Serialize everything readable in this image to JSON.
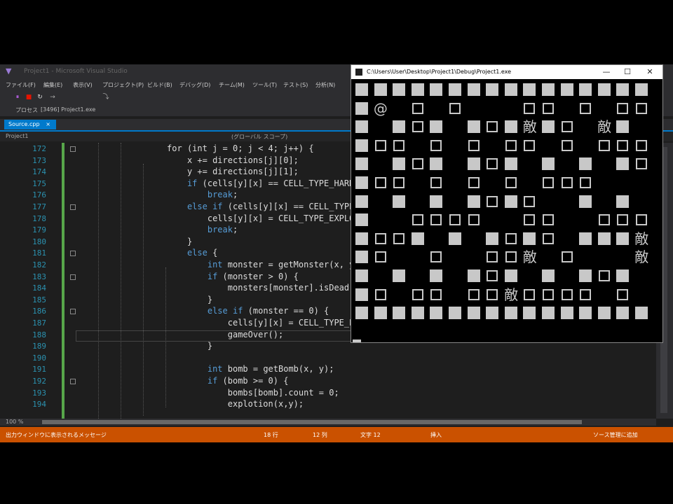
{
  "ide": {
    "title": "Project1 - Microsoft Visual Studio",
    "menu": [
      "ファイル(F)",
      "編集(E)",
      "表示(V)",
      "プロジェクト(P)",
      "ビルド(B)",
      "デバッグ(D)",
      "チーム(M)",
      "ツール(T)",
      "テスト(S)",
      "分析(N)"
    ],
    "toolbar2": [
      "プロセス",
      "[3496] Project1.exe"
    ],
    "tab": "Source.cpp",
    "tab_close": "×",
    "nav_project": "Project1",
    "nav_scope": "(グローバル スコープ)",
    "zoom": "100 %",
    "line_numbers": [
      "172",
      "173",
      "174",
      "175",
      "176",
      "177",
      "178",
      "179",
      "180",
      "181",
      "182",
      "183",
      "184",
      "185",
      "186",
      "187",
      "188",
      "189",
      "190",
      "191",
      "192",
      "193",
      "194"
    ],
    "code": [
      {
        "t": "                  for (int j = 0; j < 4; j++) {",
        "k": []
      },
      {
        "t": "                      x += directions[j][0];",
        "k": []
      },
      {
        "t": "                      y += directions[j][1];",
        "k": []
      },
      {
        "t": "                      if (cells[y][x] == CELL_TYPE_HARD_BLOCK)",
        "k": [
          "if"
        ]
      },
      {
        "t": "                          break;",
        "k": [
          "break"
        ]
      },
      {
        "t": "                      else if (cells[y][x] == CELL_TYPE_SOFT_",
        "k": [
          "else if"
        ]
      },
      {
        "t": "                          cells[y][x] = CELL_TYPE_EXPLOSION;",
        "k": []
      },
      {
        "t": "                          break;",
        "k": [
          "break"
        ]
      },
      {
        "t": "                      }",
        "k": []
      },
      {
        "t": "                      else {",
        "k": [
          "else"
        ]
      },
      {
        "t": "                          int monster = getMonster(x, y);",
        "k": [
          "int"
        ]
      },
      {
        "t": "                          if (monster > 0) {",
        "k": [
          "if"
        ]
      },
      {
        "t": "                              monsters[monster].isDead = true",
        "k": [
          "true"
        ]
      },
      {
        "t": "                          }",
        "k": []
      },
      {
        "t": "                          else if (monster == 0) {",
        "k": [
          "else if"
        ]
      },
      {
        "t": "                              cells[y][x] = CELL_TYPE_EXPLOSI",
        "k": []
      },
      {
        "t": "                              gameOver();",
        "k": []
      },
      {
        "t": "                          }",
        "k": []
      },
      {
        "t": "",
        "k": []
      },
      {
        "t": "                          int bomb = getBomb(x, y);",
        "k": [
          "int"
        ]
      },
      {
        "t": "                          if (bomb >= 0) {",
        "k": [
          "if"
        ]
      },
      {
        "t": "                              bombs[bomb].count = 0;",
        "k": []
      },
      {
        "t": "                              explotion(x,y);",
        "k": []
      }
    ],
    "status": {
      "message": "出力ウィンドウに表示されるメッセージ",
      "line": "18 行",
      "col": "12 列",
      "ch": "文字 12",
      "ins": "挿入",
      "source_control": "ソース管理に追加"
    }
  },
  "console": {
    "title": "C:\\Users\\User\\Desktop\\Project1\\Debug\\Project1.exe",
    "minimize": "—",
    "maximize": "☐",
    "close": "✕",
    "legend": {
      "H": "■",
      "S": "□",
      "@": "@",
      "E": "敵"
    },
    "grid": [
      "HHHHHHHHHHHHHHHH",
      "H@ S S   SS S SS",
      "H HSH HSH敵HS 敵H ",
      "HSS S S SS S SSS",
      "H HSH HSH H H HS",
      "HSS S S S SSS   ",
      "H H H HSHS  H H ",
      "H  SSSS  SS  SSS",
      "HSSH H HSHS HHH敵",
      "HS  S  SS敵 S   敵",
      "H H H HSH H HSH ",
      "HS SS SS敵SSSS S ",
      "HHHHHHHHHHHHHHHH"
    ]
  }
}
